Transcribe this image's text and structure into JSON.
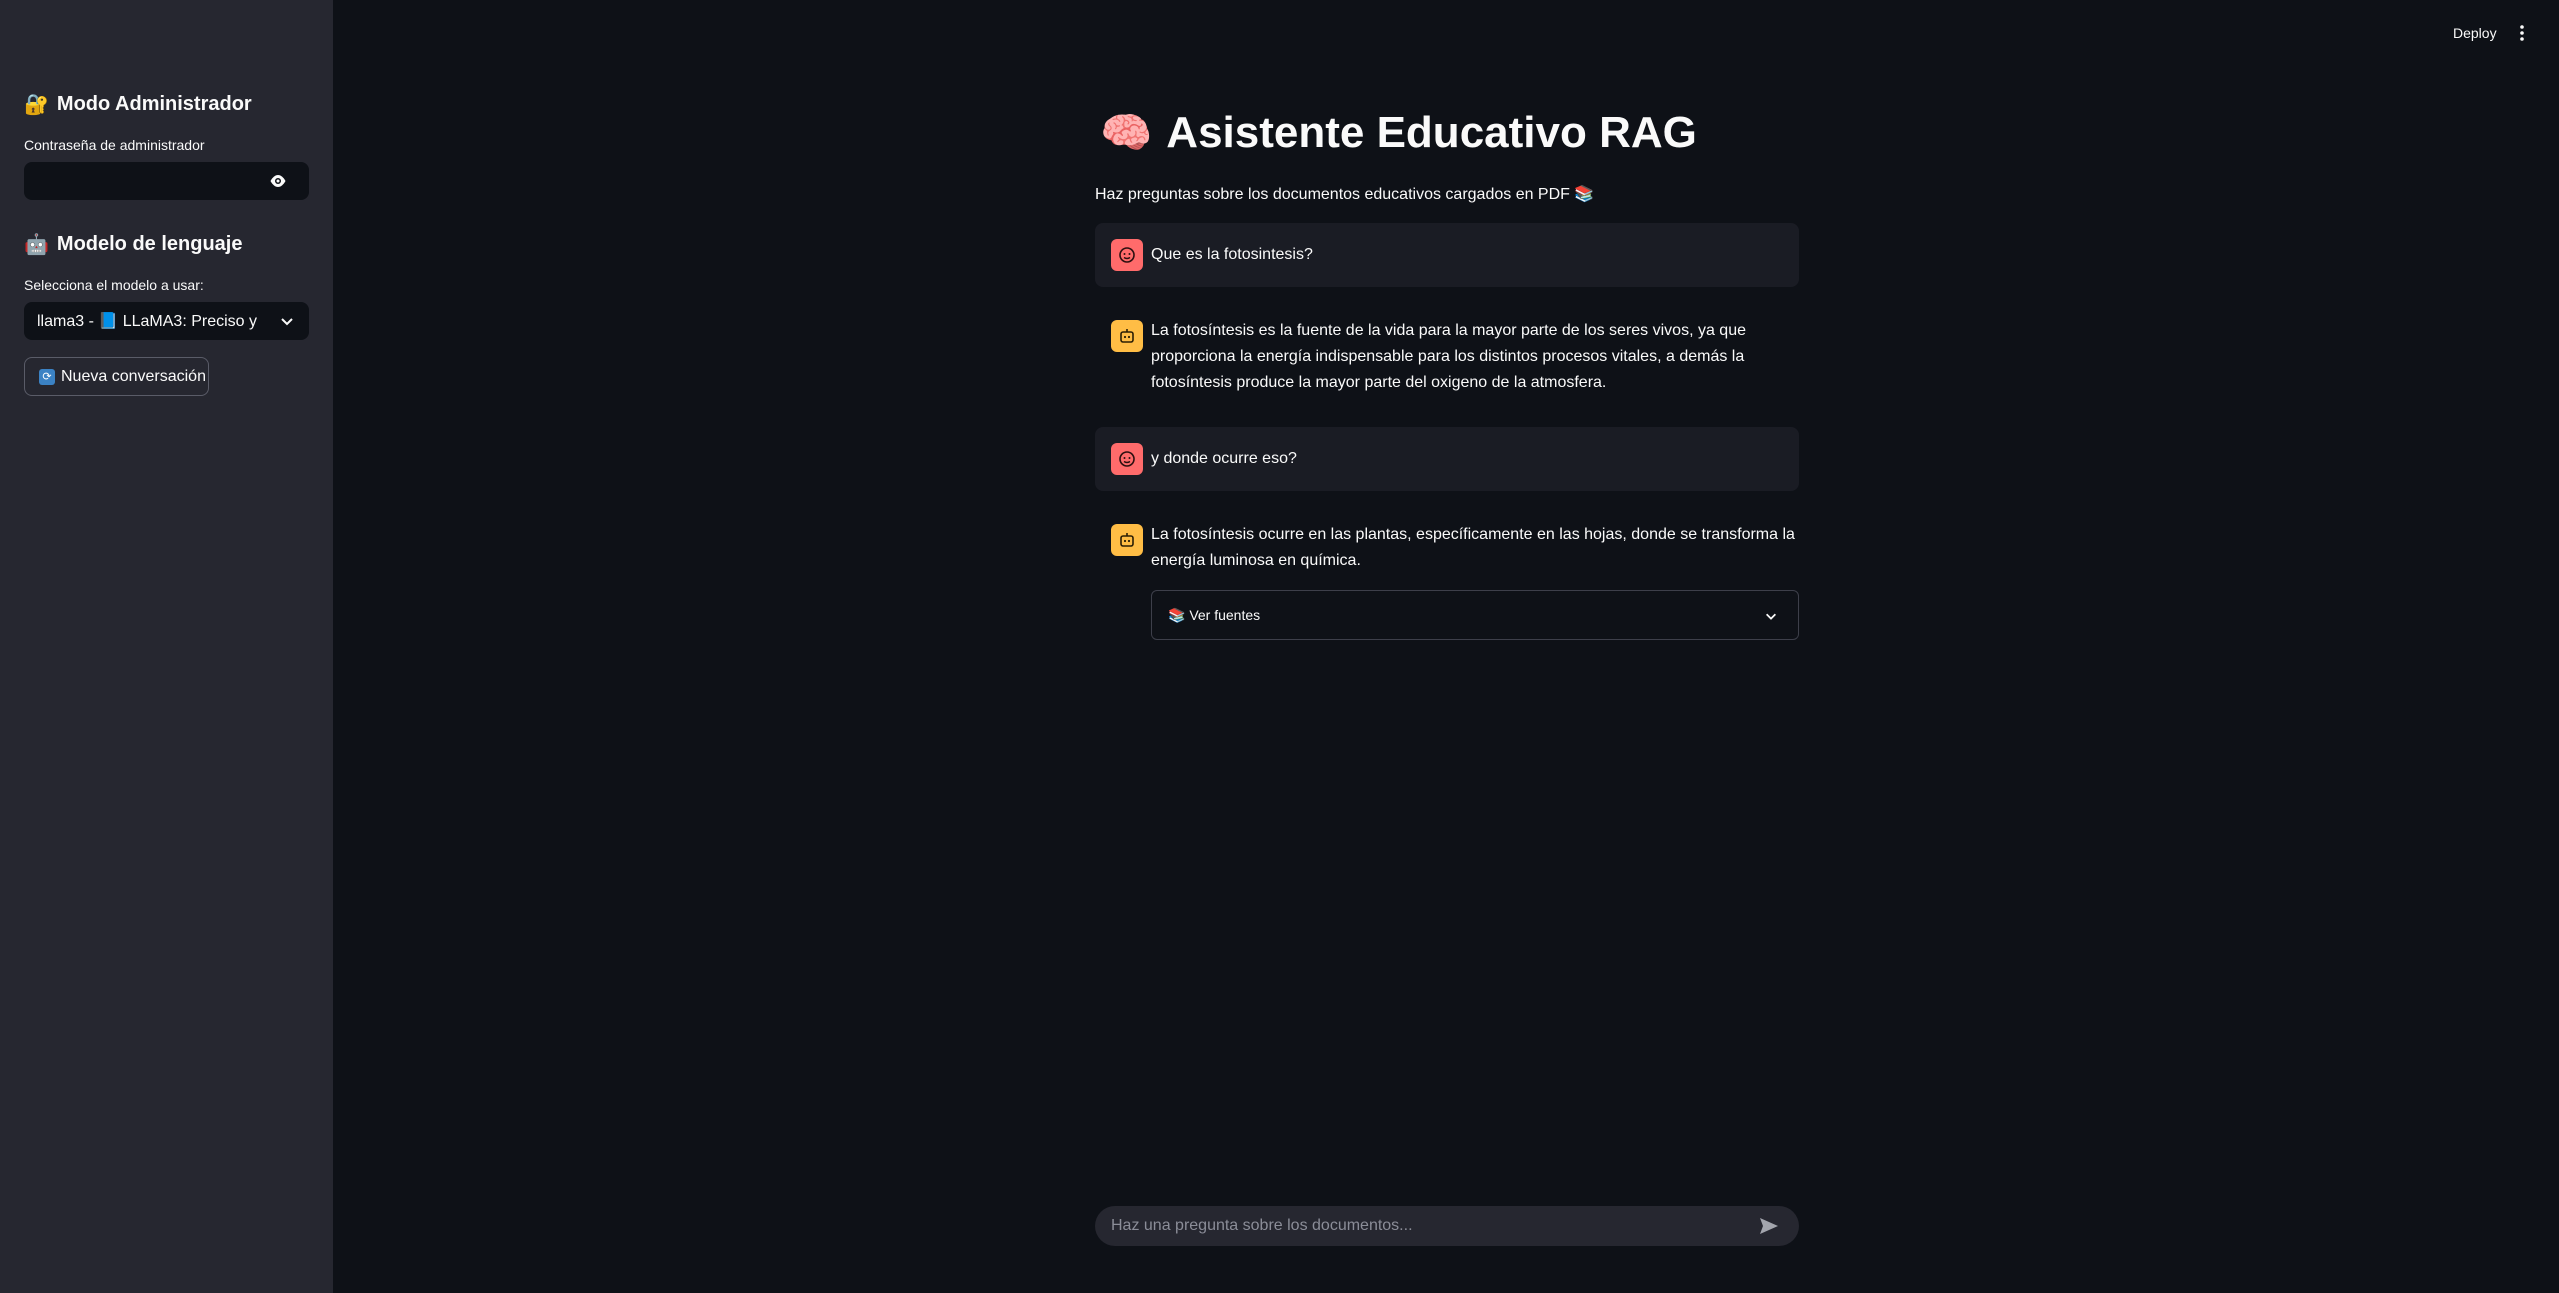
{
  "header": {
    "deploy_label": "Deploy",
    "menu_icon": "kebab-menu-icon"
  },
  "sidebar": {
    "admin_heading": "Modo Administrador",
    "admin_icon": "lock-icon",
    "password_label": "Contraseña de administrador",
    "password_value": "",
    "model_heading": "Modelo de lenguaje",
    "model_icon": "robot-icon",
    "model_label": "Selecciona el modelo a usar:",
    "model_selected": "llama3 - 📘 LLaMA3: Preciso y r…",
    "new_chat_label": "Nueva conversación"
  },
  "main": {
    "title": "Asistente Educativo RAG",
    "title_icon": "brain-icon",
    "subtitle": "Haz preguntas sobre los documentos educativos cargados en PDF 📚",
    "messages": [
      {
        "role": "user",
        "text": "Que es la fotosintesis?"
      },
      {
        "role": "assistant",
        "text": "La fotosíntesis es la fuente de la vida para la mayor parte de los seres vivos, ya que proporciona la energía indispensable para los distintos procesos vitales, a demás la fotosíntesis produce la mayor parte del oxigeno de la atmosfera."
      },
      {
        "role": "user",
        "text": "y donde ocurre eso?"
      },
      {
        "role": "assistant",
        "text": "La fotosíntesis ocurre en las plantas, específicamente en las hojas, donde se transforma la energía luminosa en química."
      }
    ],
    "sources_label": "📚 Ver fuentes",
    "chat_placeholder": "Haz una pregunta sobre los documentos..."
  },
  "colors": {
    "background": "#0e1117",
    "sidebar": "#262730",
    "user_avatar": "#ff6b6b",
    "assistant_avatar": "#ffbd45"
  }
}
